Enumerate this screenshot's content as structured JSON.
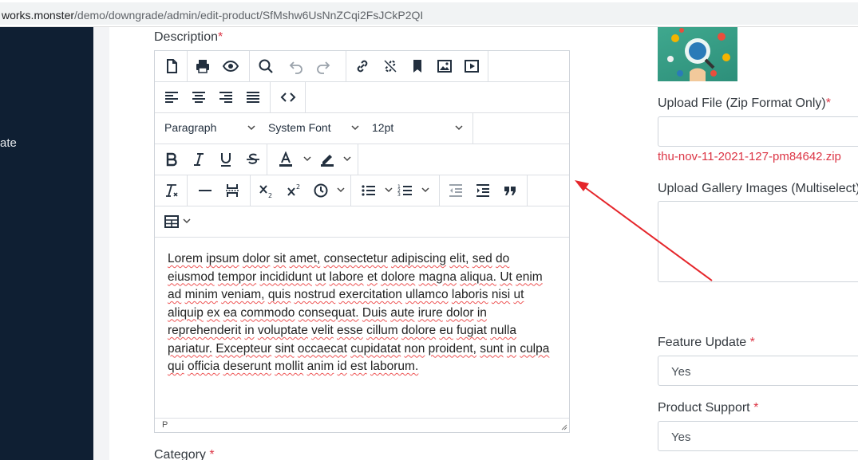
{
  "browser": {
    "url_host": "works.monster",
    "url_path": "/demo/downgrade/admin/edit-product/SfMshw6UsNnZCqi2FsJCkP2QI"
  },
  "sidebar": {
    "partial_label": "ate"
  },
  "form": {
    "description_label": "Description",
    "required_mark": "*",
    "category_label": "Category",
    "upload_file_label": "Upload File (Zip Format Only)",
    "uploaded_file_name": "thu-nov-11-2021-127-pm84642.zip",
    "gallery_label": "Upload Gallery Images (Multiselect)",
    "feature_update_label": "Feature Update",
    "feature_update_value": "Yes",
    "product_support_label": "Product Support",
    "product_support_value": "Yes"
  },
  "editor": {
    "block_format": "Paragraph",
    "font_family": "System Font",
    "font_size": "12pt",
    "status_path": "P",
    "content_words": [
      "Lorem",
      "ipsum",
      "dolor",
      "sit",
      "amet,",
      "consectetur",
      "adipiscing",
      "elit,",
      "sed",
      "do",
      "eiusmod",
      "tempor",
      "incididunt",
      "ut",
      "labore",
      "et",
      "dolore",
      "magna",
      "aliqua.",
      "Ut",
      "enim",
      "ad",
      "minim",
      "veniam,",
      "quis",
      "nostrud",
      "exercitation",
      "ullamco",
      "laboris",
      "nisi",
      "ut",
      "aliquip",
      "ex",
      "ea",
      "commodo",
      "consequat.",
      "Duis",
      "aute",
      "irure",
      "dolor",
      "in",
      "reprehenderit",
      "in",
      "voluptate",
      "velit",
      "esse",
      "cillum",
      "dolore",
      "eu",
      "fugiat",
      "nulla",
      "pariatur.",
      "Excepteur",
      "sint",
      "occaecat",
      "cupidatat",
      "non",
      "proident,",
      "sunt",
      "in",
      "culpa",
      "qui",
      "officia",
      "deserunt",
      "mollit",
      "anim",
      "id",
      "est",
      "laborum."
    ]
  },
  "colors": {
    "sidebar_bg": "#0f1f33",
    "required": "#dc3545",
    "annotation_arrow": "#e5262b"
  }
}
